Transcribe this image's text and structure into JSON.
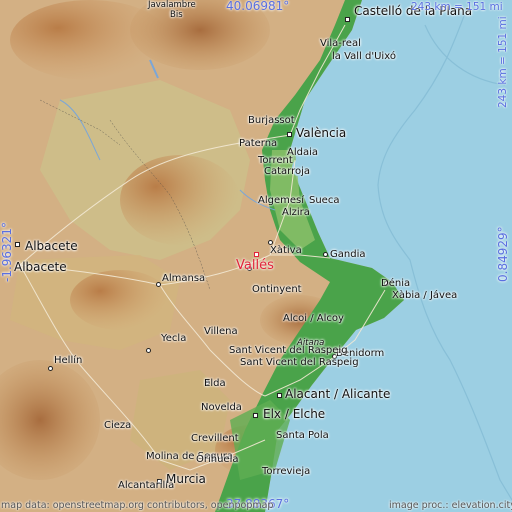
{
  "colors": {
    "sea": "#9ccfe3",
    "lowland": "#4aa34a",
    "midland": "#c9c586",
    "highland": "#c08a55",
    "target": "#e2233a",
    "coordinate": "#5a6fe0"
  },
  "coordinates": {
    "north": "40.06981°",
    "south": "37.88367°",
    "west": "-1.96321°",
    "east": "0.84929°"
  },
  "scale": {
    "horizontal": "243 km = 151 mi",
    "vertical": "243 km = 151 mi"
  },
  "target_place": "Vallés",
  "places": [
    {
      "name": "Javalambre"
    },
    {
      "name": "Bis"
    },
    {
      "name": "Castelló de la Plana"
    },
    {
      "name": "Vila-real"
    },
    {
      "name": "la Vall d'Uixó"
    },
    {
      "name": "Burjassot"
    },
    {
      "name": "València"
    },
    {
      "name": "Paterna"
    },
    {
      "name": "Aldaia"
    },
    {
      "name": "Torrent"
    },
    {
      "name": "Catarroja"
    },
    {
      "name": "Algemesí"
    },
    {
      "name": "Sueca"
    },
    {
      "name": "Alzira"
    },
    {
      "name": "Xàtiva"
    },
    {
      "name": "Gandia"
    },
    {
      "name": "Albacete"
    },
    {
      "name": "Albacete"
    },
    {
      "name": "Almansa"
    },
    {
      "name": "Ontinyent"
    },
    {
      "name": "Dénia"
    },
    {
      "name": "Xàbia / Jávea"
    },
    {
      "name": "Alcoi / Alcoy"
    },
    {
      "name": "Villena"
    },
    {
      "name": "Aitana"
    },
    {
      "name": "Yecla"
    },
    {
      "name": "Benidorm"
    },
    {
      "name": "Hellín"
    },
    {
      "name": "Sant Vicent del Raspeig"
    },
    {
      "name": "Sant Vicent del Raspeig"
    },
    {
      "name": "Elda"
    },
    {
      "name": "Alacant / Alicante"
    },
    {
      "name": "Novelda"
    },
    {
      "name": "Elx / Elche"
    },
    {
      "name": "Cieza"
    },
    {
      "name": "Crevillent"
    },
    {
      "name": "Santa Pola"
    },
    {
      "name": "Molina de Segura"
    },
    {
      "name": "Orihuela"
    },
    {
      "name": "Torrevieja"
    },
    {
      "name": "Alcantarilla"
    },
    {
      "name": "Murcia"
    }
  ],
  "credits": {
    "left": "map data: openstreetmap.org contributors, openpopmap",
    "right": "image proc.: elevation.city"
  }
}
